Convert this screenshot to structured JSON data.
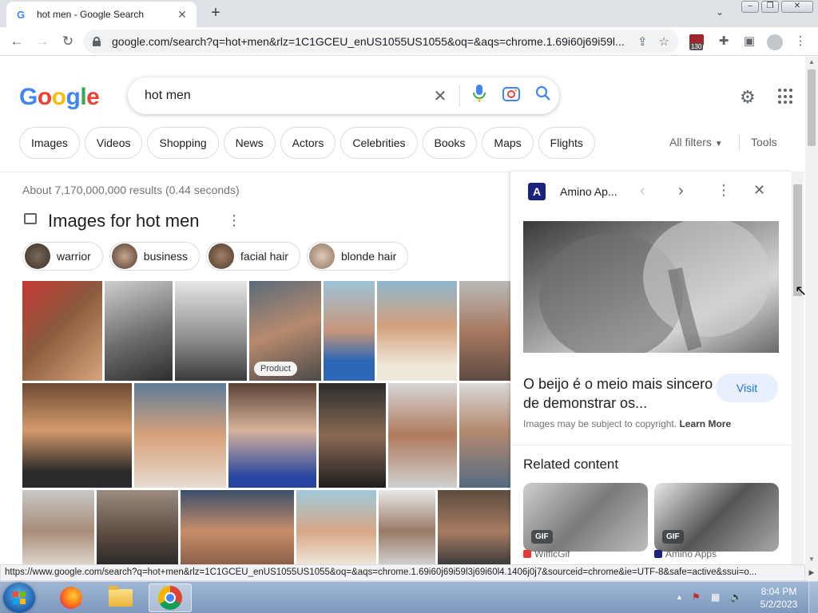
{
  "browser": {
    "tab_title": "hot men - Google Search",
    "tab_close": "✕",
    "new_tab": "+",
    "url": "google.com/search?q=hot+men&rlz=1C1GCEU_enUS1055US1055&oq=&aqs=chrome.1.69i60j69i59l...",
    "extension_badge": "130"
  },
  "search": {
    "query": "hot men",
    "chips": [
      "Images",
      "Videos",
      "Shopping",
      "News",
      "Actors",
      "Celebrities",
      "Books",
      "Maps",
      "Flights"
    ],
    "all_filters": "All filters",
    "tools": "Tools",
    "stats": "About 7,170,000,000 results (0.44 seconds)",
    "images_header": "Images for hot men",
    "refinements": [
      "warrior",
      "business",
      "facial hair",
      "blonde hair"
    ],
    "product_badge": "Product"
  },
  "panel": {
    "site": "Amino Ap...",
    "title": "O beijo é o meio mais sincero de demonstrar os...",
    "visit": "Visit",
    "copyright": "Images may be subject to copyright.",
    "learn_more": "Learn More",
    "related_header": "Related content",
    "gif_label": "GIF",
    "related": [
      {
        "source": "WifflcGif",
        "color": "#e53935"
      },
      {
        "source": "Amino Apps",
        "color": "#1a237e"
      }
    ]
  },
  "status_url": "https://www.google.com/search?q=hot+men&rlz=1C1GCEU_enUS1055US1055&oq=&aqs=chrome.1.69i60j69i59l3j69i60l4.1406j0j7&sourceid=chrome&ie=UTF-8&safe=active&ssui=o...",
  "taskbar": {
    "time": "8:04 PM",
    "date": "5/2/2023"
  },
  "colors": {
    "accent_blue": "#1a73e8",
    "google_blue": "#4285f4",
    "google_red": "#ea4335",
    "google_yellow": "#fbbc05",
    "google_green": "#34a853"
  }
}
